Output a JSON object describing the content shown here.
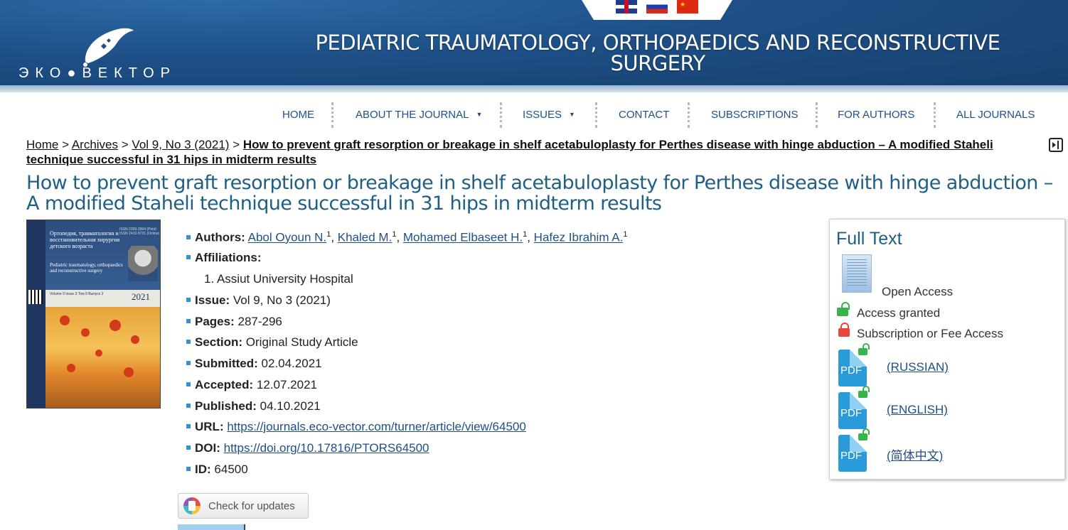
{
  "header": {
    "logo_text": "ЭКО●ВЕКТОР",
    "journal_title": "PEDIATRIC TRAUMATOLOGY, ORTHOPAEDICS AND RECONSTRUCTIVE SURGERY",
    "languages": [
      "English",
      "Russian",
      "Chinese"
    ]
  },
  "nav": {
    "items": [
      {
        "label": "HOME"
      },
      {
        "label": "ABOUT THE JOURNAL",
        "dropdown": true
      },
      {
        "label": "ISSUES",
        "dropdown": true
      },
      {
        "label": "CONTACT"
      },
      {
        "label": "SUBSCRIPTIONS"
      },
      {
        "label": "FOR AUTHORS"
      },
      {
        "label": "ALL JOURNALS"
      }
    ],
    "caret": "▼"
  },
  "breadcrumb": {
    "home": "Home",
    "archives": "Archives",
    "issue": "Vol 9, No 3 (2021)",
    "separator": ">",
    "current": "How to prevent graft resorption or breakage in shelf acetabuloplasty for Perthes disease with hinge abduction – A modified Staheli technique successful in 31 hips in midterm results"
  },
  "article": {
    "title": "How to prevent graft resorption or breakage in shelf acetabuloplasty for Perthes disease with hinge abduction – A modified Staheli technique successful in 31 hips in midterm results",
    "cover": {
      "title_ru": "Ортопедия, травматология и восстановительная хирургия детского возраста",
      "title_en": "Pediatric traumatology, orthopaedics and reconstructive surgery",
      "issn": "ISSN 2309-3994 (Print) ISSN 2410-8731 (Online)",
      "volume_line": "Volume 9 Issue 3",
      "volume_line_ru": "Том 9 Выпуск 3",
      "year": "2021"
    },
    "labels": {
      "authors": "Authors:",
      "affiliations": "Affiliations:",
      "issue": "Issue:",
      "pages": "Pages:",
      "section": "Section:",
      "submitted": "Submitted:",
      "accepted": "Accepted:",
      "published": "Published:",
      "url": "URL:",
      "doi": "DOI:",
      "id": "ID:"
    },
    "authors": [
      {
        "name": "Abol Oyoun N.",
        "sup": "1"
      },
      {
        "name": "Khaled M.",
        "sup": "1"
      },
      {
        "name": "Mohamed Elbaseet H.",
        "sup": "1"
      },
      {
        "name": "Hafez Ibrahim A.",
        "sup": "1"
      }
    ],
    "author_separator": ", ",
    "affiliation": "1. Assiut University Hospital",
    "issue": "Vol 9, No 3 (2021)",
    "pages": "287-296",
    "section": "Original Study Article",
    "submitted": "02.04.2021",
    "accepted": "12.07.2021",
    "published": "04.10.2021",
    "url": "https://journals.eco-vector.com/turner/article/view/64500",
    "doi": "https://doi.org/10.17816/PTORS64500",
    "id": "64500",
    "check_updates": "Check for updates"
  },
  "fulltext": {
    "title": "Full Text",
    "open_access": "Open Access",
    "access_granted": "Access granted",
    "subscription": "Subscription or Fee Access",
    "pdf_label": "PDF",
    "files": [
      {
        "label": "(RUSSIAN)"
      },
      {
        "label": "(ENGLISH)"
      },
      {
        "label": "(简体中文)"
      }
    ]
  },
  "colors": {
    "header_blue": "#1d4f86",
    "title_teal": "#1f5f86",
    "link_blue": "#1f4f86",
    "bullet_blue": "#3a8fd0",
    "lock_green": "#36b34a",
    "lock_red": "#e8453c",
    "pdf_blue": "#2a9ad8"
  }
}
